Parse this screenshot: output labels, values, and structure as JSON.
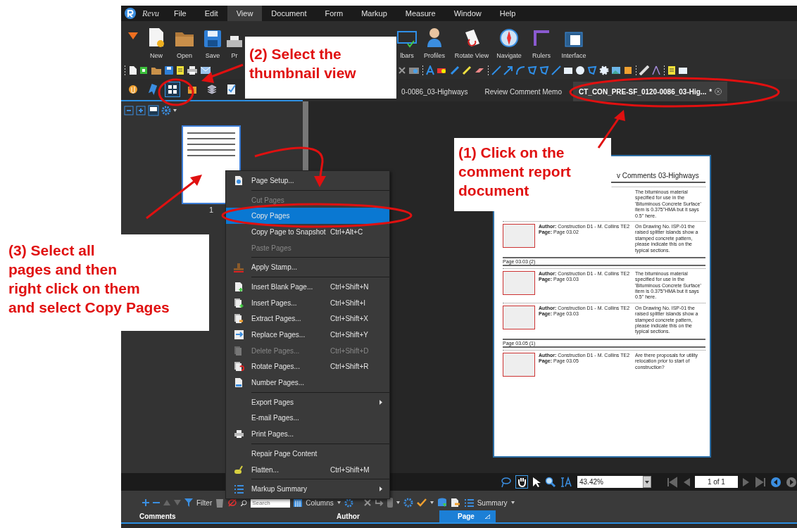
{
  "menu_bar": {
    "app_name": "Revu",
    "items": [
      {
        "label": "File",
        "selected": false
      },
      {
        "label": "Edit",
        "selected": false
      },
      {
        "label": "View",
        "selected": true
      },
      {
        "label": "Document",
        "selected": false
      },
      {
        "label": "Form",
        "selected": false
      },
      {
        "label": "Markup",
        "selected": false
      },
      {
        "label": "Measure",
        "selected": false
      },
      {
        "label": "Window",
        "selected": false
      },
      {
        "label": "Help",
        "selected": false
      }
    ]
  },
  "ribbon": {
    "left": [
      {
        "kind": "new",
        "label": "New"
      },
      {
        "kind": "open",
        "label": "Open"
      },
      {
        "kind": "save",
        "label": "Save"
      },
      {
        "kind": "print",
        "label": "Pr"
      }
    ],
    "right": [
      {
        "kind": "toolbars",
        "label": "lbars"
      },
      {
        "kind": "profiles",
        "label": "Profiles"
      },
      {
        "kind": "rotate",
        "label": "Rotate View"
      },
      {
        "kind": "navigate",
        "label": "Navigate"
      },
      {
        "kind": "rulers",
        "label": "Rulers"
      },
      {
        "kind": "interface",
        "label": "Interface"
      }
    ]
  },
  "panel_tabs": [
    {
      "kind": "attachments",
      "selected": false
    },
    {
      "kind": "bookmarks",
      "selected": false
    },
    {
      "kind": "thumbnails",
      "selected": true
    },
    {
      "kind": "file-access",
      "selected": false
    },
    {
      "kind": "layers",
      "selected": false
    },
    {
      "kind": "markups",
      "selected": false
    }
  ],
  "document_tabs": [
    {
      "label": "0-0086_03-Highways",
      "selected": false,
      "modified": false
    },
    {
      "label": "Review Comment Memo",
      "selected": false,
      "modified": false
    },
    {
      "label": "CT_CON_PRE-SF_0120-0086_03-Hig...",
      "selected": true,
      "modified": true,
      "modified_mark": "*"
    }
  ],
  "thumbnails": [
    {
      "page_label": "1",
      "selected": true
    }
  ],
  "context_menu": {
    "items": [
      {
        "kind": "item",
        "label": "Page Setup...",
        "disabled": false,
        "selected": false,
        "submenu": false
      },
      {
        "kind": "separator"
      },
      {
        "kind": "item",
        "label": "Cut Pages",
        "disabled": true,
        "selected": false,
        "submenu": false
      },
      {
        "kind": "item",
        "label": "Copy Pages",
        "disabled": false,
        "selected": true,
        "submenu": false
      },
      {
        "kind": "item",
        "label": "Copy Page to Snapshot",
        "shortcut": "Ctrl+Alt+C",
        "disabled": false,
        "selected": false,
        "submenu": false
      },
      {
        "kind": "item",
        "label": "Paste Pages",
        "disabled": true,
        "selected": false,
        "submenu": false
      },
      {
        "kind": "separator"
      },
      {
        "kind": "item",
        "label": "Apply Stamp...",
        "disabled": false,
        "selected": false,
        "submenu": false
      },
      {
        "kind": "separator"
      },
      {
        "kind": "item",
        "label": "Insert Blank Page...",
        "shortcut": "Ctrl+Shift+N",
        "disabled": false,
        "selected": false,
        "submenu": false
      },
      {
        "kind": "item",
        "label": "Insert Pages...",
        "shortcut": "Ctrl+Shift+I",
        "disabled": false,
        "selected": false,
        "submenu": false
      },
      {
        "kind": "item",
        "label": "Extract Pages...",
        "shortcut": "Ctrl+Shift+X",
        "disabled": false,
        "selected": false,
        "submenu": false
      },
      {
        "kind": "item",
        "label": "Replace Pages...",
        "shortcut": "Ctrl+Shift+Y",
        "disabled": false,
        "selected": false,
        "submenu": false
      },
      {
        "kind": "item",
        "label": "Delete Pages...",
        "shortcut": "Ctrl+Shift+D",
        "disabled": true,
        "selected": false,
        "submenu": false
      },
      {
        "kind": "item",
        "label": "Rotate Pages...",
        "shortcut": "Ctrl+Shift+R",
        "disabled": false,
        "selected": false,
        "submenu": false
      },
      {
        "kind": "item",
        "label": "Number Pages...",
        "disabled": false,
        "selected": false,
        "submenu": false
      },
      {
        "kind": "separator"
      },
      {
        "kind": "item",
        "label": "Export Pages",
        "disabled": false,
        "selected": false,
        "submenu": true
      },
      {
        "kind": "item",
        "label": "E-mail Pages...",
        "disabled": false,
        "selected": false,
        "submenu": false
      },
      {
        "kind": "item",
        "label": "Print Pages...",
        "disabled": false,
        "selected": false,
        "submenu": false
      },
      {
        "kind": "separator"
      },
      {
        "kind": "item",
        "label": "Repair Page Content",
        "disabled": false,
        "selected": false,
        "submenu": false
      },
      {
        "kind": "item",
        "label": "Flatten...",
        "shortcut": "Ctrl+Shift+M",
        "disabled": false,
        "selected": false,
        "submenu": false
      },
      {
        "kind": "separator"
      },
      {
        "kind": "item",
        "label": "Markup Summary",
        "disabled": false,
        "selected": false,
        "submenu": true
      }
    ]
  },
  "document": {
    "title": "v Comments 03-Highways",
    "blocks": [
      {
        "kind": "comment",
        "comment": "The bituminous material specified for use in the 'Bituminous Concrete Surface' item is 0.375\"HMA but it says 0.5\" here."
      },
      {
        "kind": "comment",
        "author": "**Author:** Construction D1 - M. Collins TE2",
        "page": "**Page:** Page 03.02",
        "comment": "On Drawing No. ISP-01 the raised splitter islands show a stamped concrete pattern, please indicate this on the typical sections."
      },
      {
        "kind": "heading",
        "text": "Page 03.03 (2)"
      },
      {
        "kind": "comment",
        "author": "**Author:** Construction D1 - M. Collins TE2",
        "page": "**Page:** Page 03.03",
        "comment": "The bituminous material specified for use in the 'Bituminous Concrete Surface' item is 0.375\"HMA but it says 0.5\" here."
      },
      {
        "kind": "comment",
        "author": "**Author:** Construction D1 - M. Collins TE2",
        "page": "**Page:** Page 03.03",
        "comment": "On Drawing No. ISP-01 the raised splitter islands show a stamped concrete pattern, please indicate this on the typical sections."
      },
      {
        "kind": "heading",
        "text": "Page 03.05 (1)"
      },
      {
        "kind": "comment",
        "author": "**Author:** Construction D1 - M. Collins TE2",
        "page": "**Page:** Page 03.05",
        "comment": "Are there proposals for utility relocation prior to start of construction?"
      }
    ]
  },
  "nav_bar": {
    "zoom": "43.42%",
    "page_field": "1 of 1"
  },
  "markup_list": {
    "filter_label": "Filter",
    "search": {
      "placeholder": "Search"
    },
    "columns_label": "Columns",
    "summary_label": "Summary",
    "columns": [
      {
        "label": "Comments",
        "selected": false
      },
      {
        "label": "Author",
        "selected": false
      },
      {
        "label": "Page",
        "selected": true
      }
    ]
  },
  "callouts": [
    {
      "kind": "step2",
      "text": "(2) Select the\nthumbnail view"
    },
    {
      "kind": "step1",
      "text": "(1) Click on the\ncomment report\ndocument"
    },
    {
      "kind": "step3",
      "text": "(3) Select all\npages and then\nright click on them\nand select Copy Pages"
    }
  ]
}
